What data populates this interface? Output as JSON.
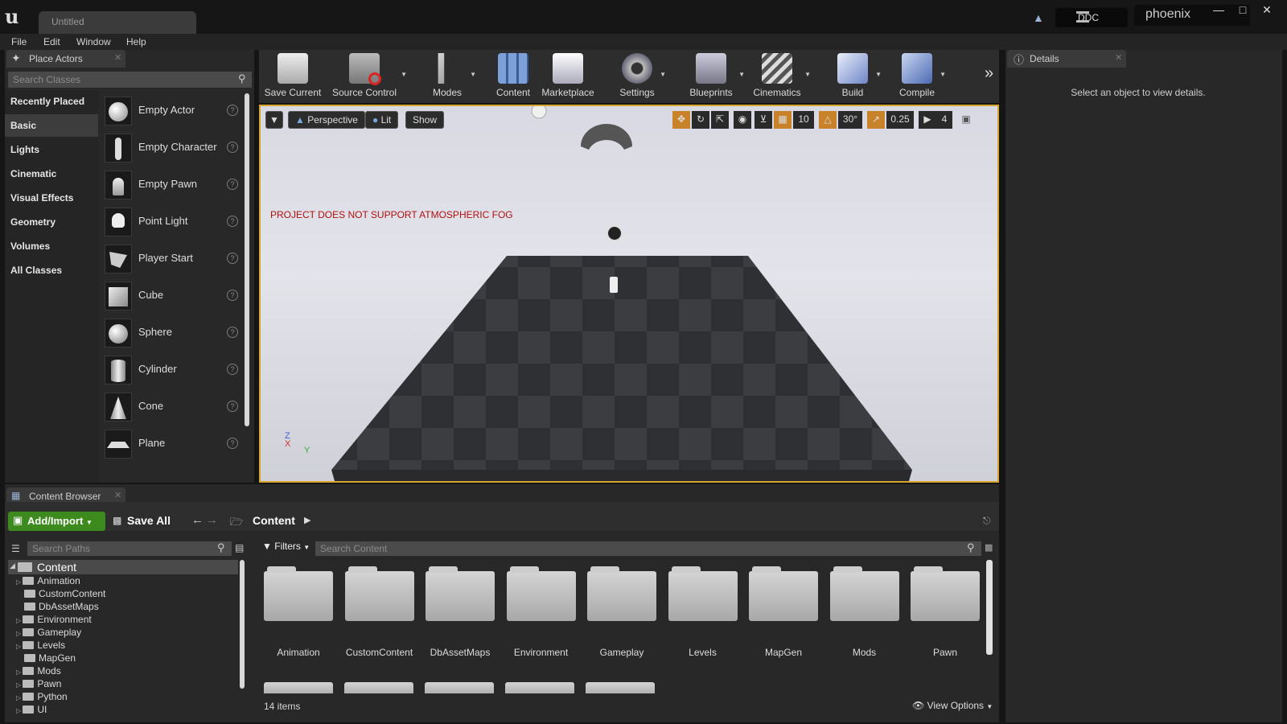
{
  "window": {
    "doc_tab": "Untitled",
    "ddc_label": "DDC",
    "user": "phoenix"
  },
  "menu": [
    "File",
    "Edit",
    "Window",
    "Help"
  ],
  "place_actors": {
    "tab_label": "Place Actors",
    "search_placeholder": "Search Classes",
    "categories": [
      "Recently Placed",
      "Basic",
      "Lights",
      "Cinematic",
      "Visual Effects",
      "Geometry",
      "Volumes",
      "All Classes"
    ],
    "active_category": "Basic",
    "actors": [
      "Empty Actor",
      "Empty Character",
      "Empty Pawn",
      "Point Light",
      "Player Start",
      "Cube",
      "Sphere",
      "Cylinder",
      "Cone",
      "Plane"
    ]
  },
  "toolbar": {
    "buttons": [
      "Save Current",
      "Source Control",
      "Modes",
      "Content",
      "Marketplace",
      "Settings",
      "Blueprints",
      "Cinematics",
      "Build",
      "Compile"
    ]
  },
  "viewport": {
    "perspective": "Perspective",
    "lit": "Lit",
    "show": "Show",
    "grid_snap": "10",
    "rotation_snap": "30°",
    "scale_snap": "0.25",
    "camera_speed": "4",
    "warning": "PROJECT DOES NOT SUPPORT ATMOSPHERIC FOG",
    "axis_z": "Z",
    "axis_x": "X",
    "axis_y": "Y"
  },
  "details": {
    "tab_label": "Details",
    "empty_message": "Select an object to view details."
  },
  "content_browser": {
    "tab_label": "Content Browser",
    "add_import": "Add/Import",
    "save_all": "Save All",
    "path": "Content",
    "search_paths_placeholder": "Search Paths",
    "search_content_placeholder": "Search Content",
    "filters": "Filters",
    "tree_root": "Content",
    "tree": [
      "Animation",
      "CustomContent",
      "DbAssetMaps",
      "Environment",
      "Gameplay",
      "Levels",
      "MapGen",
      "Mods",
      "Pawn",
      "Python",
      "UI"
    ],
    "tiles": [
      "Animation",
      "CustomContent",
      "DbAssetMaps",
      "Environment",
      "Gameplay",
      "Levels",
      "MapGen",
      "Mods",
      "Pawn"
    ],
    "item_count": "14 items",
    "view_options": "View Options"
  }
}
